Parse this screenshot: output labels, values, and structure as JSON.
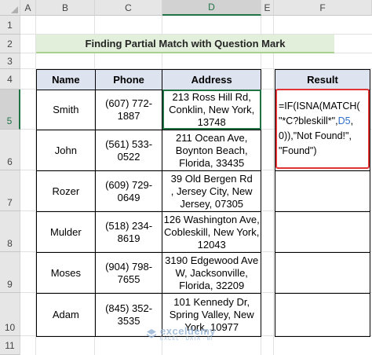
{
  "columns": [
    "A",
    "B",
    "C",
    "D",
    "E",
    "F"
  ],
  "rows": [
    "1",
    "2",
    "3",
    "4",
    "5",
    "6",
    "7",
    "8",
    "9",
    "10",
    "11"
  ],
  "title": "Finding Partial Match with Question Mark",
  "table": {
    "headers": [
      "Name",
      "Phone",
      "Address"
    ],
    "rows": [
      {
        "name": "Smith",
        "phone": [
          "(607) 772-",
          "1887"
        ],
        "address": [
          "213 Ross Hill Rd,",
          "Conklin, New York,",
          "13748"
        ]
      },
      {
        "name": "John",
        "phone": [
          "(561) 533-",
          "0522"
        ],
        "address": [
          "211 Ocean Ave,",
          "Boynton Beach,",
          "Florida, 33435"
        ]
      },
      {
        "name": "Rozer",
        "phone": [
          "(609) 729-",
          "0649"
        ],
        "address": [
          "39 Old Bergen Rd",
          ", Jersey City, New",
          "Jersey, 07305"
        ]
      },
      {
        "name": "Mulder",
        "phone": [
          "(518) 234-",
          "8619"
        ],
        "address": [
          "126 Washington Ave,",
          "Cobleskill, New York,",
          "12043"
        ]
      },
      {
        "name": "Moses",
        "phone": [
          "(904) 798-",
          "7655"
        ],
        "address": [
          "3190 Edgewood Ave",
          "W, Jacksonville,",
          "Florida, 32209"
        ]
      },
      {
        "name": "Adam",
        "phone": [
          "(845) 352-",
          "3535"
        ],
        "address": [
          "101 Kennedy Dr,",
          "Spring Valley, New",
          "York, 10977"
        ]
      }
    ]
  },
  "result": {
    "header": "Result",
    "formula_parts": {
      "l1": "=IF(ISNA(MATCH(",
      "l2a": "\"*C?bleskill*\",",
      "l2ref": "D5",
      "l2b": ",",
      "l3": "0)),\"Not Found!\",",
      "l4": "\"Found\")"
    }
  },
  "watermark": {
    "name": "exceldemy",
    "tagline": "EXCEL · DATA · BI"
  },
  "colors": {
    "title_bg": "#e2efda",
    "header_bg": "#dde4f0",
    "highlight_border": "#e03333",
    "active_cell": "#217346",
    "ref_blue": "#2f6fcc"
  }
}
